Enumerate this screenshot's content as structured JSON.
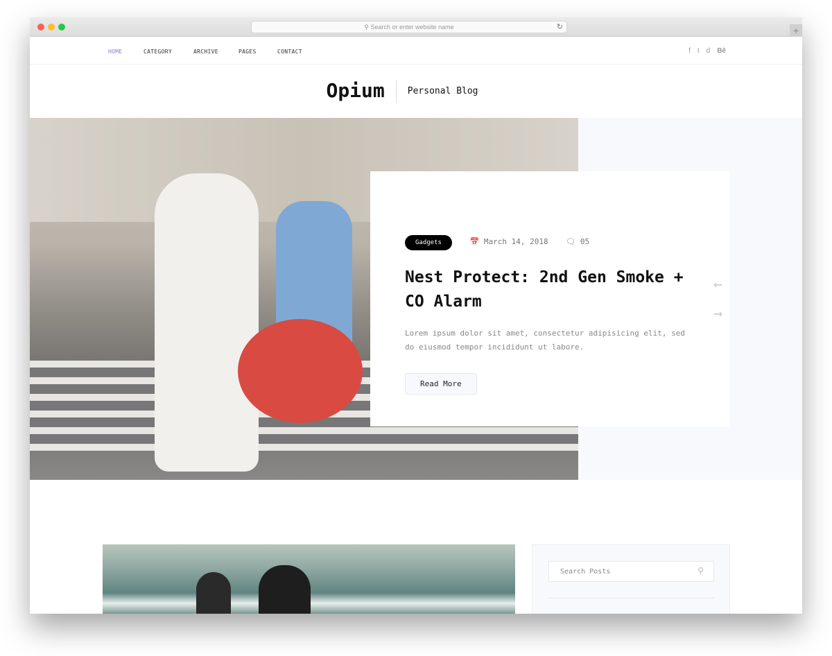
{
  "browser": {
    "address_placeholder": "Search or enter website name",
    "colors": {
      "close": "#ff5f57",
      "minimize": "#febc2e",
      "zoom": "#28c840"
    }
  },
  "nav": {
    "items": [
      {
        "label": "HOME",
        "active": true
      },
      {
        "label": "CATEGORY"
      },
      {
        "label": "ARCHIVE"
      },
      {
        "label": "PAGES"
      },
      {
        "label": "CONTACT"
      }
    ],
    "active_color": "#7b83d6",
    "social": [
      "f",
      "t",
      "d",
      "Bē"
    ]
  },
  "brand": {
    "logo": "Opium",
    "tagline": "Personal Blog"
  },
  "hero": {
    "category": "Gadgets",
    "date": "March 14, 2018",
    "comments": "05",
    "title": "Nest Protect: 2nd Gen Smoke + CO Alarm",
    "excerpt": "Lorem ipsum dolor sit amet, consectetur adipisicing elit, sed do eiusmod tempor incididunt ut labore.",
    "button": "Read More",
    "prev": "←",
    "next": "→"
  },
  "sidebar": {
    "search_placeholder": "Search Posts"
  }
}
